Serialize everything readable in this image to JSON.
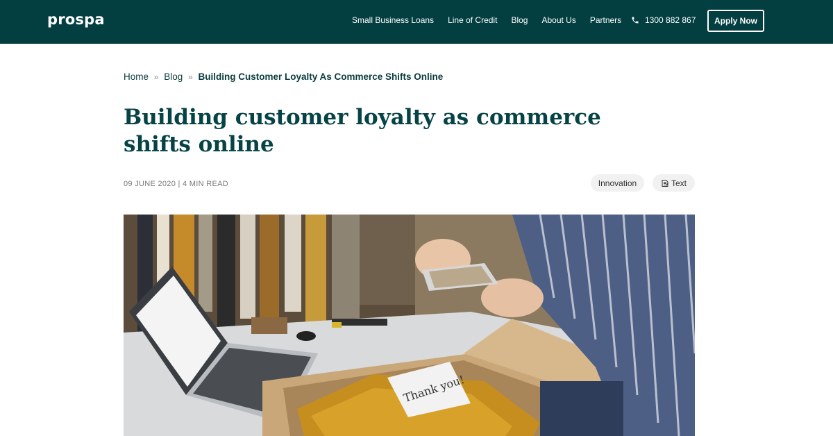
{
  "header": {
    "logo": "prospa",
    "nav": [
      "Small Business Loans",
      "Line of Credit",
      "Blog",
      "About Us",
      "Partners"
    ],
    "phone": "1300 882 867",
    "apply_label": "Apply Now"
  },
  "breadcrumb": {
    "home": "Home",
    "blog": "Blog",
    "separator": "»",
    "current": "Building Customer Loyalty As Commerce Shifts Online"
  },
  "article": {
    "title": "Building customer loyalty as commerce shifts online",
    "meta": "09 JUNE 2020 | 4 MIN READ",
    "tags": [
      "Innovation",
      "Text"
    ],
    "image_note_text": "Thank you!"
  },
  "colors": {
    "header_bg": "#033e41",
    "title_color": "#064345",
    "tag_bg": "#f1f1f1"
  }
}
